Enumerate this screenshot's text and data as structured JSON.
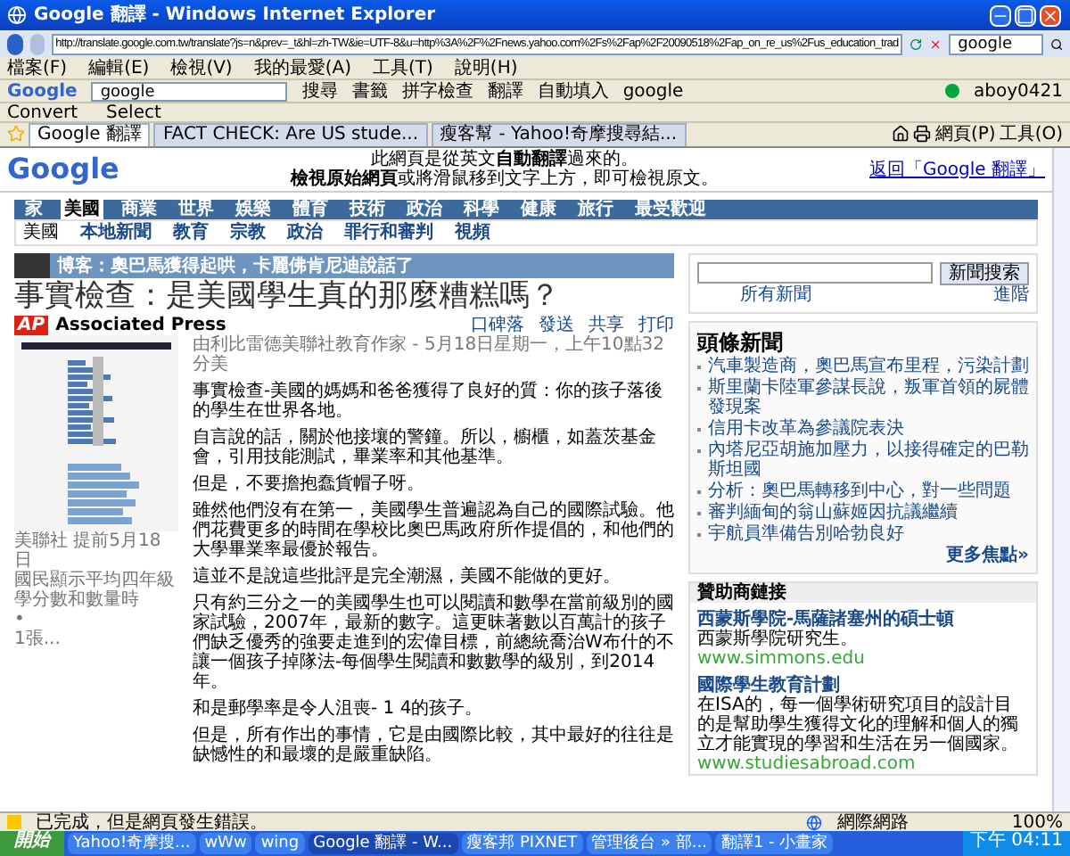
{
  "window": {
    "title": "Google 翻譯 - Windows Internet Explorer"
  },
  "address_bar": {
    "url": "http://translate.google.com.tw/translate?js=n&prev=_t&hl=zh-TW&ie=UTF-8&u=http%3A%2F%2Fnews.yahoo.com%2Fs%2Fap%2F20090518%2Fap_on_re_us%2Fus_education_trad",
    "search": "google"
  },
  "menu": [
    "檔案(F)",
    "編輯(E)",
    "檢視(V)",
    "我的最愛(A)",
    "工具(T)",
    "說明(H)"
  ],
  "google_toolbar": {
    "logo": "Google",
    "query": "google",
    "items": [
      "搜尋",
      "書籤",
      "拼字檢查",
      "翻譯",
      "自動填入",
      "google"
    ],
    "account": "aboy0421"
  },
  "addon_toolbar": [
    "Convert",
    "Select"
  ],
  "tabs": [
    {
      "label": "Google 翻譯",
      "selected": true
    },
    {
      "label": "FACT CHECK: Are US stude...",
      "selected": false
    },
    {
      "label": "瘦客幫 - Yahoo!奇摩搜尋結...",
      "selected": false
    }
  ],
  "command_bar": [
    "網頁(P)",
    "工具(O)"
  ],
  "translate_header": {
    "logo": "Google",
    "line_1": "此網頁是從英文**自動翻譯**過來的。",
    "line_2": "**檢視原始網頁**或將滑鼠移到文字上方，即可檢視原文。",
    "back_link": "返回「Google 翻譯」"
  },
  "nav": [
    {
      "label": "家",
      "selected": false
    },
    {
      "label": "美國",
      "selected": true
    },
    {
      "label": "商業",
      "selected": false
    },
    {
      "label": "世界",
      "selected": false
    },
    {
      "label": "娛樂",
      "selected": false
    },
    {
      "label": "體育",
      "selected": false
    },
    {
      "label": "技術",
      "selected": false
    },
    {
      "label": "政治",
      "selected": false
    },
    {
      "label": "科學",
      "selected": false
    },
    {
      "label": "健康",
      "selected": false
    },
    {
      "label": "旅行",
      "selected": false
    },
    {
      "label": "最受歡迎",
      "selected": false
    }
  ],
  "subnav": {
    "heading": "美國",
    "items": [
      "本地新聞",
      "教育",
      "宗教",
      "政治",
      "罪行和審判",
      "視頻"
    ]
  },
  "banner": {
    "label": "博客：",
    "text": "奧巴馬獲得起哄，卡麗佛肯尼迪說話了"
  },
  "article": {
    "headline": "事實檢查：是美國學生真的那麼糟糕嗎？",
    "source": "Associated Press",
    "logo": "AP",
    "actions": [
      "口碑落",
      "發送",
      "共享",
      "打印"
    ],
    "byline": "由利比雷德美聯社教育作家 - 5月18日星期一，上午10點32分美",
    "image_caption": [
      "美聯社 提前5月18日",
      "國民顯示平均四年級學分數和數量時",
      "•",
      "1張..."
    ],
    "paragraphs": [
      "事實檢查-美國的媽媽和爸爸獲得了良好的質：你的孩子落後的學生在世界各地。",
      "自言說的話，關於他接壤的警鐘。所以，櫥櫃，如蓋茨基金會，引用技能測試，畢業率和其他基準。",
      "但是，不要擔抱蠢貨帽子呀。",
      "雖然他們沒有在第一，美國學生普遍認為自己的國際試驗。他們花費更多的時間在學校比奧巴馬政府所作提倡的，和他們的大學畢業率最優於報告。",
      "這並不是說這些批評是完全潮濕，美國不能做的更好。",
      "只有約三分之一的美國學生也可以閱讀和數學在當前級別的國家試驗，2007年，最新的數字。這更昧著數以百萬計的孩子們缺乏優秀的強要走進到的宏偉目標，前總統喬治W布什的不讓一個孩子掉隊法-每個學生閱讀和數數學的級別，到2014年。",
      "和是郵學率是令人沮喪- 1 4的孩子。",
      "但是，所有作出的事情，它是由國際比較，其中最好的往往是缺憾性的和最壞的是嚴重缺陷。"
    ]
  },
  "sidebar": {
    "search_button": "新聞搜索",
    "search_scope": "所有新聞",
    "advanced": "進階",
    "top_news": {
      "title": "頭條新聞",
      "items": [
        "汽車製造商，奧巴馬宣布里程，污染計劃",
        "斯里蘭卡陸軍參謀長說，叛軍首領的屍體發現案",
        "信用卡改革為參議院表決",
        "內塔尼亞胡施加壓力，以接得確定的巴勒斯坦國",
        "分析：奧巴馬轉移到中心，對一些問題",
        "審判緬甸的翁山蘇姬因抗議繼續",
        "宇航員準備告別哈勃良好"
      ],
      "more": "更多焦點»"
    },
    "sponsors": {
      "title": "贊助商鏈接",
      "items": [
        {
          "title": "西蒙斯學院-馬薩諸塞州的碩士頓",
          "text": "西蒙斯學院研究生。",
          "url": "www.simmons.edu"
        },
        {
          "title": "國際學生教育計劃",
          "text": "在ISA的，每一個學術研究項目的設計目的是幫助學生獲得文化的理解和個人的獨立才能實現的學習和生活在另一個國家。",
          "url": "www.studiesabroad.com"
        }
      ]
    }
  },
  "status_bar": {
    "text": "已完成，但是網頁發生錯誤。",
    "zone": "網際網路",
    "zoom": "100%"
  },
  "taskbar": {
    "start": "開始",
    "items": [
      {
        "label": "Yahoo!奇摩搜...",
        "selected": false
      },
      {
        "label": "wWw",
        "selected": false
      },
      {
        "label": "wing",
        "selected": false
      },
      {
        "label": "Google 翻譯 - W...",
        "selected": true
      },
      {
        "label": "瘦客邦 PIXNET",
        "selected": false
      },
      {
        "label": "管理後台 » 部...",
        "selected": false
      },
      {
        "label": "翻譯1 - 小畫家",
        "selected": false
      }
    ],
    "clock": "下午 04:11"
  }
}
